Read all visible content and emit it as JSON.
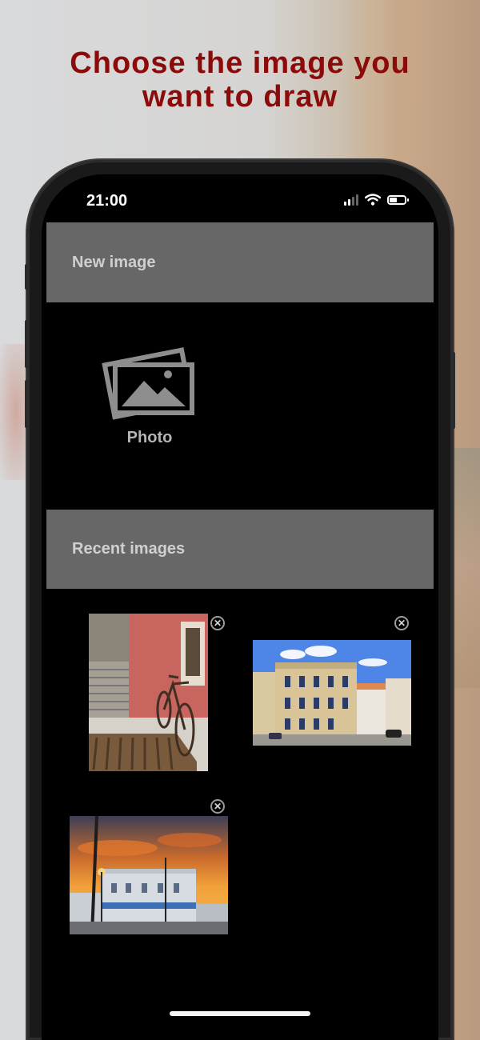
{
  "headline": {
    "line1": "Choose the image you",
    "line2": "want to draw",
    "color": "#8b0a0a"
  },
  "status_bar": {
    "time": "21:00",
    "icons": [
      "cellular-signal-icon",
      "wifi-icon",
      "battery-icon"
    ]
  },
  "new_image": {
    "header": "New image",
    "photo_button": {
      "label": "Photo",
      "icon": "photo-gallery-icon"
    }
  },
  "recent_images": {
    "header": "Recent images",
    "items": [
      {
        "subject": "bicycle-against-red-wall",
        "remove_icon": "close-circle-icon"
      },
      {
        "subject": "street-buildings-blue-sky",
        "remove_icon": "close-circle-icon"
      },
      {
        "subject": "building-at-sunset",
        "remove_icon": "close-circle-icon"
      }
    ]
  },
  "colors": {
    "screen_bg": "#000000",
    "section_header_bg": "#676767",
    "section_header_text": "#d0d0d0"
  }
}
